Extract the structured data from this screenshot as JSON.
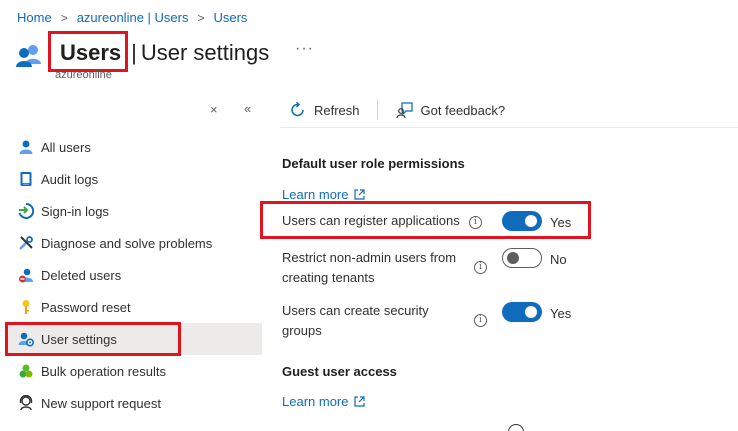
{
  "breadcrumb": {
    "items": [
      "Home",
      "azureonline | Users",
      "Users"
    ],
    "separator": ">"
  },
  "header": {
    "title": "Users",
    "title_separator": "|",
    "subtitle": "User settings",
    "more": "···",
    "tenant": "azureonline",
    "icon": "users-icon"
  },
  "sidebar": {
    "close": "×",
    "collapse": "«",
    "items": [
      {
        "label": "All users",
        "icon": "user-icon"
      },
      {
        "label": "Audit logs",
        "icon": "audit-log-icon"
      },
      {
        "label": "Sign-in logs",
        "icon": "sign-in-icon"
      },
      {
        "label": "Diagnose and solve problems",
        "icon": "wrench-icon"
      },
      {
        "label": "Deleted users",
        "icon": "deleted-user-icon"
      },
      {
        "label": "Password reset",
        "icon": "key-icon"
      },
      {
        "label": "User settings",
        "icon": "user-settings-icon",
        "active": true
      },
      {
        "label": "Bulk operation results",
        "icon": "bulk-icon"
      },
      {
        "label": "New support request",
        "icon": "support-icon"
      }
    ]
  },
  "toolbar": {
    "refresh": "Refresh",
    "feedback": "Got feedback?"
  },
  "settings": {
    "default_section": "Default user role permissions",
    "learn_more": "Learn more",
    "register_apps": {
      "label": "Users can register applications",
      "state": "Yes",
      "on": true
    },
    "restrict_tenants": {
      "label_line1": "Restrict non-admin users from",
      "label_line2": "creating tenants",
      "state": "No",
      "on": false
    },
    "security_groups": {
      "label_line1": "Users can create security",
      "label_line2": "groups",
      "state": "Yes",
      "on": true
    },
    "guest_section": "Guest user access",
    "guest_learn_more": "Learn more"
  },
  "colors": {
    "accent": "#0f6cbd",
    "highlight": "#e0141e",
    "active_bg": "#edebe9"
  }
}
